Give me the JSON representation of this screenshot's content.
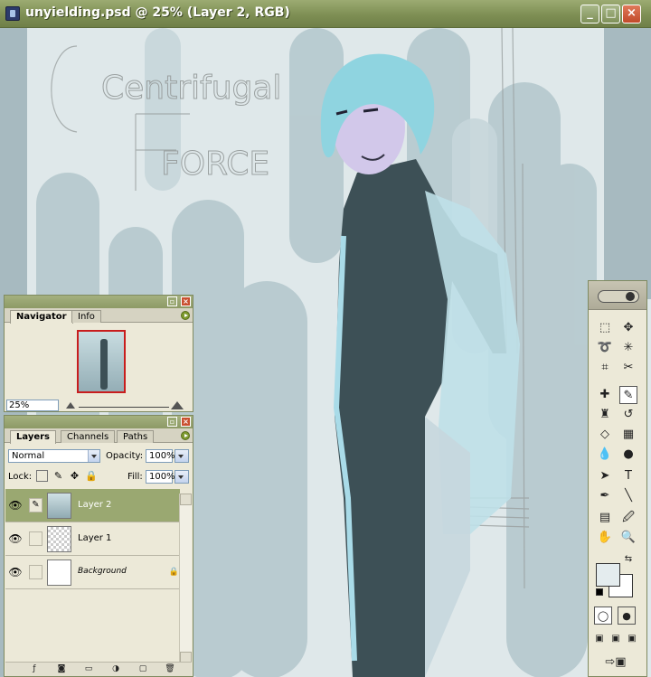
{
  "window": {
    "title": "unyielding.psd @ 25% (Layer 2, RGB)"
  },
  "canvas": {
    "sketch_text_1": "Centrifugal",
    "sketch_text_2": "FORCE"
  },
  "navigator": {
    "tabs": [
      "Navigator",
      "Info"
    ],
    "zoom": "25%"
  },
  "layers_panel": {
    "tabs": [
      "Layers",
      "Channels",
      "Paths"
    ],
    "blend_mode": "Normal",
    "opacity_label": "Opacity:",
    "opacity": "100%",
    "lock_label": "Lock:",
    "fill_label": "Fill:",
    "fill": "100%",
    "layers": [
      {
        "name": "Layer 2",
        "selected": true,
        "locked": false
      },
      {
        "name": "Layer 1",
        "selected": false,
        "locked": false
      },
      {
        "name": "Background",
        "selected": false,
        "locked": true
      }
    ]
  },
  "tools": {
    "type_tool": "T"
  },
  "colors": {
    "title_bar": "#8d9a66",
    "selected_layer": "#9aa871",
    "canvas_bg": "#dfe8ea",
    "figure_dark": "#3d5056",
    "hair": "#8fd4e0"
  }
}
